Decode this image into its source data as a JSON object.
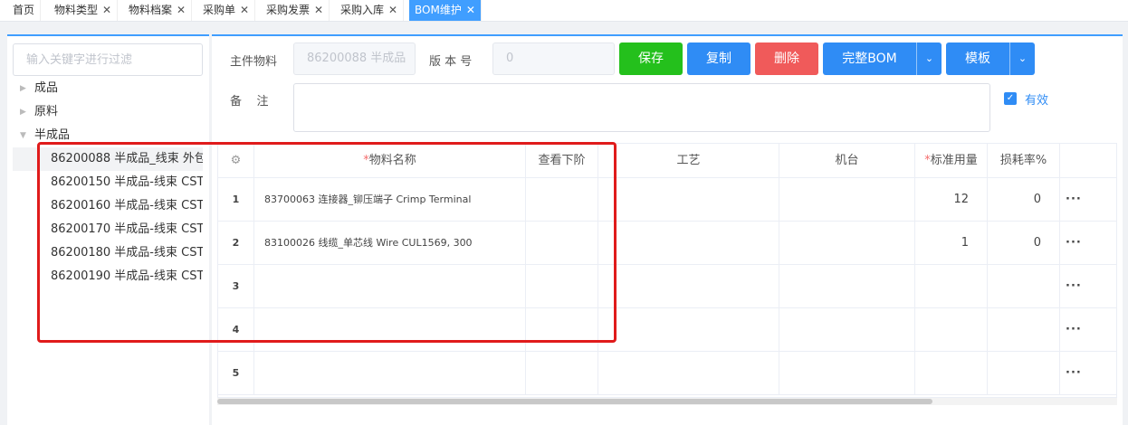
{
  "tabs": [
    {
      "label": "首页",
      "closable": false,
      "active": false
    },
    {
      "label": "物料类型",
      "closable": true,
      "active": false
    },
    {
      "label": "物料档案",
      "closable": true,
      "active": false
    },
    {
      "label": "采购单",
      "closable": true,
      "active": false
    },
    {
      "label": "采购发票",
      "closable": true,
      "active": false
    },
    {
      "label": "采购入库",
      "closable": true,
      "active": false
    },
    {
      "label": "BOM维护",
      "closable": true,
      "active": true
    }
  ],
  "tree": {
    "filter_placeholder": "输入关键字进行过滤",
    "nodes": [
      {
        "label": "成品",
        "expanded": false
      },
      {
        "label": "原料",
        "expanded": false
      },
      {
        "label": "半成品",
        "expanded": true
      }
    ],
    "children": [
      {
        "label": "86200088 半成品_线束 外包",
        "selected": true
      },
      {
        "label": "86200150 半成品-线束 CST",
        "selected": false
      },
      {
        "label": "86200160 半成品-线束 CST",
        "selected": false
      },
      {
        "label": "86200170 半成品-线束 CST",
        "selected": false
      },
      {
        "label": "86200180 半成品-线束 CST",
        "selected": false
      },
      {
        "label": "86200190 半成品-线束 CST",
        "selected": false
      }
    ]
  },
  "form": {
    "main_material_label": "主件物料",
    "main_material_value": "86200088 半成品",
    "version_label": "版 本 号",
    "version_value": "0",
    "remark_label": "备    注",
    "valid_label": "有效",
    "valid_checked": true
  },
  "toolbar": {
    "save": "保存",
    "copy": "复制",
    "delete": "删除",
    "full_bom": "完整BOM",
    "template": "模板",
    "caret": "⌄"
  },
  "grid": {
    "settings_icon": "⚙",
    "headers": {
      "material_name": "物料名称",
      "view_lower": "查看下阶",
      "process": "工艺",
      "machine": "机台",
      "std_qty": "标准用量",
      "loss_rate": "损耗率%"
    },
    "required_mark": "*",
    "more": "···",
    "rows": [
      {
        "no": "1",
        "material": "83700063 连接器_铆压端子 Crimp Terminal",
        "qty": "12",
        "loss": "0"
      },
      {
        "no": "2",
        "material": "83100026 线缆_单芯线 Wire CUL1569, 300",
        "qty": "1",
        "loss": "0"
      },
      {
        "no": "3",
        "material": "",
        "qty": "",
        "loss": ""
      },
      {
        "no": "4",
        "material": "",
        "qty": "",
        "loss": ""
      },
      {
        "no": "5",
        "material": "",
        "qty": "",
        "loss": ""
      }
    ]
  },
  "colors": {
    "primary": "#409eff",
    "success": "#24c01c",
    "danger": "#f05a5a",
    "highlight": "#e01b1b"
  }
}
